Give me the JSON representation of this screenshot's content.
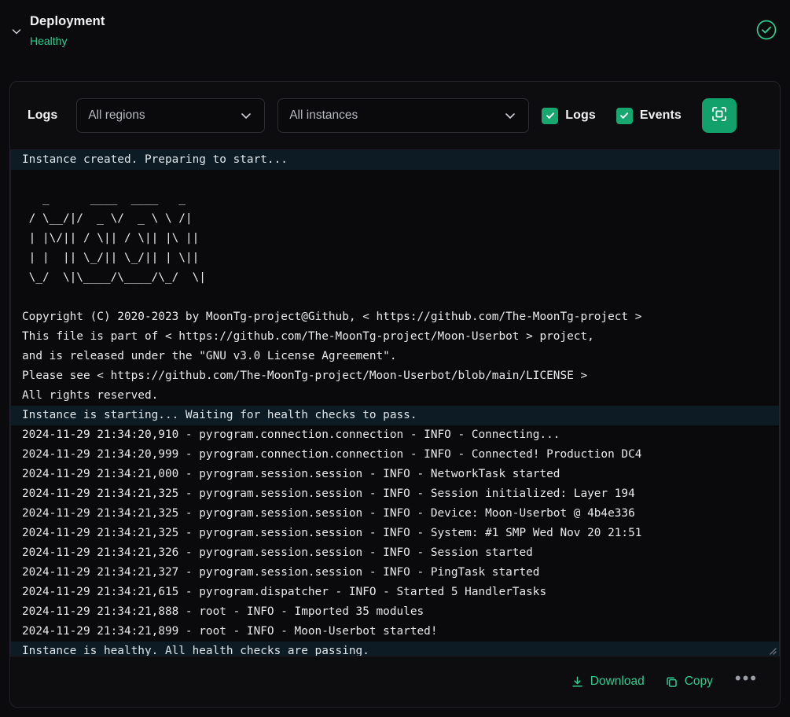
{
  "header": {
    "title": "Deployment",
    "status": "Healthy",
    "status_color": "#2ecc8f",
    "collapse_icon": "chevron-down-icon",
    "health_icon": "check-circle-icon"
  },
  "toolbar": {
    "label": "Logs",
    "region_select": {
      "value": "All regions",
      "caret_icon": "chevron-down-icon"
    },
    "instance_select": {
      "value": "All instances",
      "caret_icon": "chevron-down-icon"
    },
    "checkboxes": [
      {
        "label": "Logs",
        "checked": true
      },
      {
        "label": "Events",
        "checked": true
      }
    ],
    "expand_button": {
      "icon": "fullscreen-icon",
      "color": "#12a06b"
    }
  },
  "log": {
    "lines": [
      {
        "text": "Instance created. Preparing to start...",
        "type": "system"
      },
      {
        "text": "",
        "type": "blank"
      },
      {
        "text": "   _      ____  ____   _",
        "type": "out"
      },
      {
        "text": " / \\__/|/  _ \\/  _ \\ \\ /|",
        "type": "out"
      },
      {
        "text": " | |\\/|| / \\|| / \\|| |\\ ||",
        "type": "out"
      },
      {
        "text": " | |  || \\_/|| \\_/|| | \\||",
        "type": "out"
      },
      {
        "text": " \\_/  \\|\\____/\\____/\\_/  \\|",
        "type": "out"
      },
      {
        "text": "",
        "type": "blank"
      },
      {
        "text": "Copyright (C) 2020-2023 by MoonTg-project@Github, < https://github.com/The-MoonTg-project >",
        "type": "out"
      },
      {
        "text": "This file is part of < https://github.com/The-MoonTg-project/Moon-Userbot > project,",
        "type": "out"
      },
      {
        "text": "and is released under the \"GNU v3.0 License Agreement\".",
        "type": "out"
      },
      {
        "text": "Please see < https://github.com/The-MoonTg-project/Moon-Userbot/blob/main/LICENSE >",
        "type": "out"
      },
      {
        "text": "All rights reserved.",
        "type": "out"
      },
      {
        "text": "Instance is starting... Waiting for health checks to pass.",
        "type": "system"
      },
      {
        "text": "2024-11-29 21:34:20,910 - pyrogram.connection.connection - INFO - Connecting...",
        "type": "out"
      },
      {
        "text": "2024-11-29 21:34:20,999 - pyrogram.connection.connection - INFO - Connected! Production DC4",
        "type": "out"
      },
      {
        "text": "2024-11-29 21:34:21,000 - pyrogram.session.session - INFO - NetworkTask started",
        "type": "out"
      },
      {
        "text": "2024-11-29 21:34:21,325 - pyrogram.session.session - INFO - Session initialized: Layer 194",
        "type": "out"
      },
      {
        "text": "2024-11-29 21:34:21,325 - pyrogram.session.session - INFO - Device: Moon-Userbot @ 4b4e336",
        "type": "out"
      },
      {
        "text": "2024-11-29 21:34:21,325 - pyrogram.session.session - INFO - System: #1 SMP Wed Nov 20 21:51",
        "type": "out"
      },
      {
        "text": "2024-11-29 21:34:21,326 - pyrogram.session.session - INFO - Session started",
        "type": "out"
      },
      {
        "text": "2024-11-29 21:34:21,327 - pyrogram.session.session - INFO - PingTask started",
        "type": "out"
      },
      {
        "text": "2024-11-29 21:34:21,615 - pyrogram.dispatcher - INFO - Started 5 HandlerTasks",
        "type": "out"
      },
      {
        "text": "2024-11-29 21:34:21,888 - root - INFO - Imported 35 modules",
        "type": "out"
      },
      {
        "text": "2024-11-29 21:34:21,899 - root - INFO - Moon-Userbot started!",
        "type": "out"
      },
      {
        "text": "Instance is healthy. All health checks are passing.",
        "type": "system"
      }
    ],
    "resize_handle": "resize-grip-icon"
  },
  "footer": {
    "download": {
      "label": "Download",
      "icon": "download-icon"
    },
    "copy": {
      "label": "Copy",
      "icon": "copy-icon"
    },
    "more": {
      "label": "•••",
      "icon": "ellipsis-icon"
    },
    "accent_color": "#2ecc8f"
  }
}
